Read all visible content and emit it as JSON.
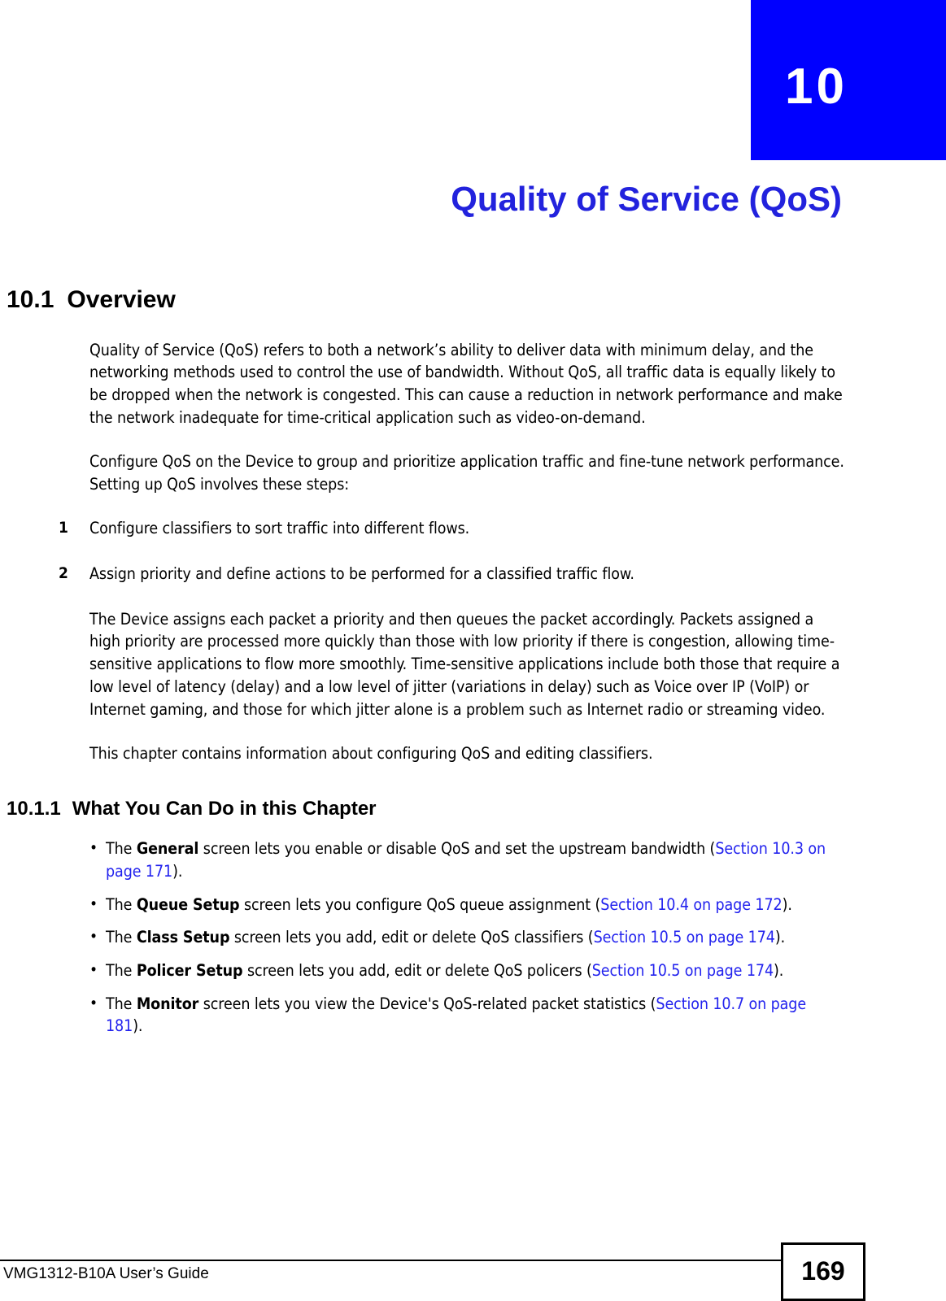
{
  "chapter": {
    "number": "10",
    "title": "Quality of Service (QoS)",
    "banner_color": "#0000ff",
    "title_color": "#2222dd"
  },
  "section": {
    "number": "10.1",
    "title": "Overview",
    "paragraphs": [
      "Quality of Service (QoS) refers to both a network’s ability to deliver data with minimum delay, and the networking methods used to control the use of bandwidth. Without QoS, all traffic data is equally likely to be dropped when the network is congested. This can cause a reduction in network performance and make the network inadequate for time-critical application such as video-on-demand.",
      "Configure QoS on the Device to group and prioritize application traffic and fine-tune network performance. Setting up QoS involves these steps:"
    ],
    "steps": [
      {
        "num": "1",
        "text": "Configure classifiers to sort traffic into different flows."
      },
      {
        "num": "2",
        "text": "Assign priority and define actions to be performed for a classified traffic flow."
      }
    ],
    "paragraphs_after": [
      "The Device assigns each packet a priority and then queues the packet accordingly. Packets assigned a high priority are processed more quickly than those with low priority if there is congestion, allowing time-sensitive applications to flow more smoothly. Time-sensitive applications include both those that require a low level of latency (delay) and a low level of jitter (variations in delay) such as Voice over IP (VoIP) or Internet gaming, and those for which jitter alone is a problem such as Internet radio or streaming video.",
      "This chapter contains information about configuring QoS and editing classifiers."
    ]
  },
  "subsection": {
    "number": "10.1.1",
    "title": "What You Can Do in this Chapter",
    "bullet_marker": "•",
    "bullets": [
      {
        "lead": "The ",
        "screen": "General",
        "body": " screen lets you enable or disable QoS and set the upstream bandwidth (",
        "xref": "Section 10.3 on page 171",
        "tail": ")."
      },
      {
        "lead": "The ",
        "screen": "Queue Setup",
        "body": " screen lets you configure QoS queue assignment (",
        "xref": "Section 10.4 on page 172",
        "tail": ")."
      },
      {
        "lead": "The ",
        "screen": "Class Setup",
        "body": " screen lets you add, edit or delete QoS classifiers (",
        "xref": "Section 10.5 on page 174",
        "tail": ")."
      },
      {
        "lead": "The ",
        "screen": "Policer Setup",
        "body": " screen lets you add, edit or delete QoS policers (",
        "xref": "Section 10.5 on page 174",
        "tail": ")."
      },
      {
        "lead": "The ",
        "screen": "Monitor",
        "body": " screen lets you view the Device's QoS-related packet statistics (",
        "xref": "Section 10.7 on page 181",
        "tail": ")."
      }
    ],
    "xref_color": "#2222ee"
  },
  "footer": {
    "guide_name": "VMG1312-B10A User’s Guide",
    "page_number": "169"
  }
}
